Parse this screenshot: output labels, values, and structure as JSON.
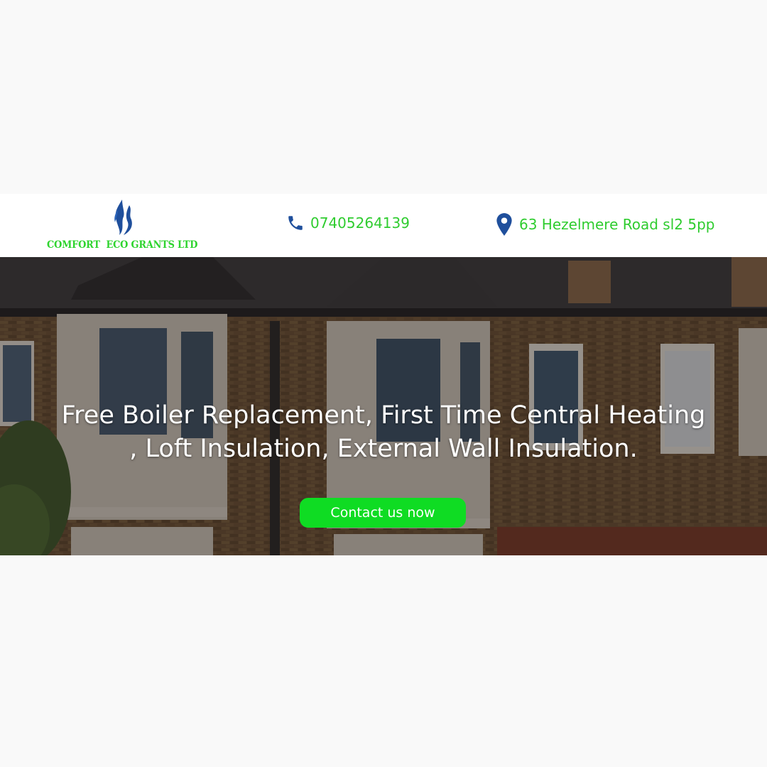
{
  "header": {
    "logo_text": "COMFORT  ECO GRANTS LTD",
    "phone": "07405264139",
    "address": "63 Hezelmere Road sl2 5pp",
    "icons": {
      "logo": "flame-logo-icon",
      "phone": "phone-icon",
      "address": "map-pin-icon"
    }
  },
  "hero": {
    "headline_line1": "Free Boiler Replacement, First Time Central Heating",
    "headline_line2": ", Loft Insulation, External Wall Insulation.",
    "cta_label": "Contact us now"
  },
  "colors": {
    "brand_green": "#2fcc2f",
    "button_green": "#0fdc23",
    "icon_blue": "#1f4f9c",
    "page_background": "#f9f9f9"
  }
}
